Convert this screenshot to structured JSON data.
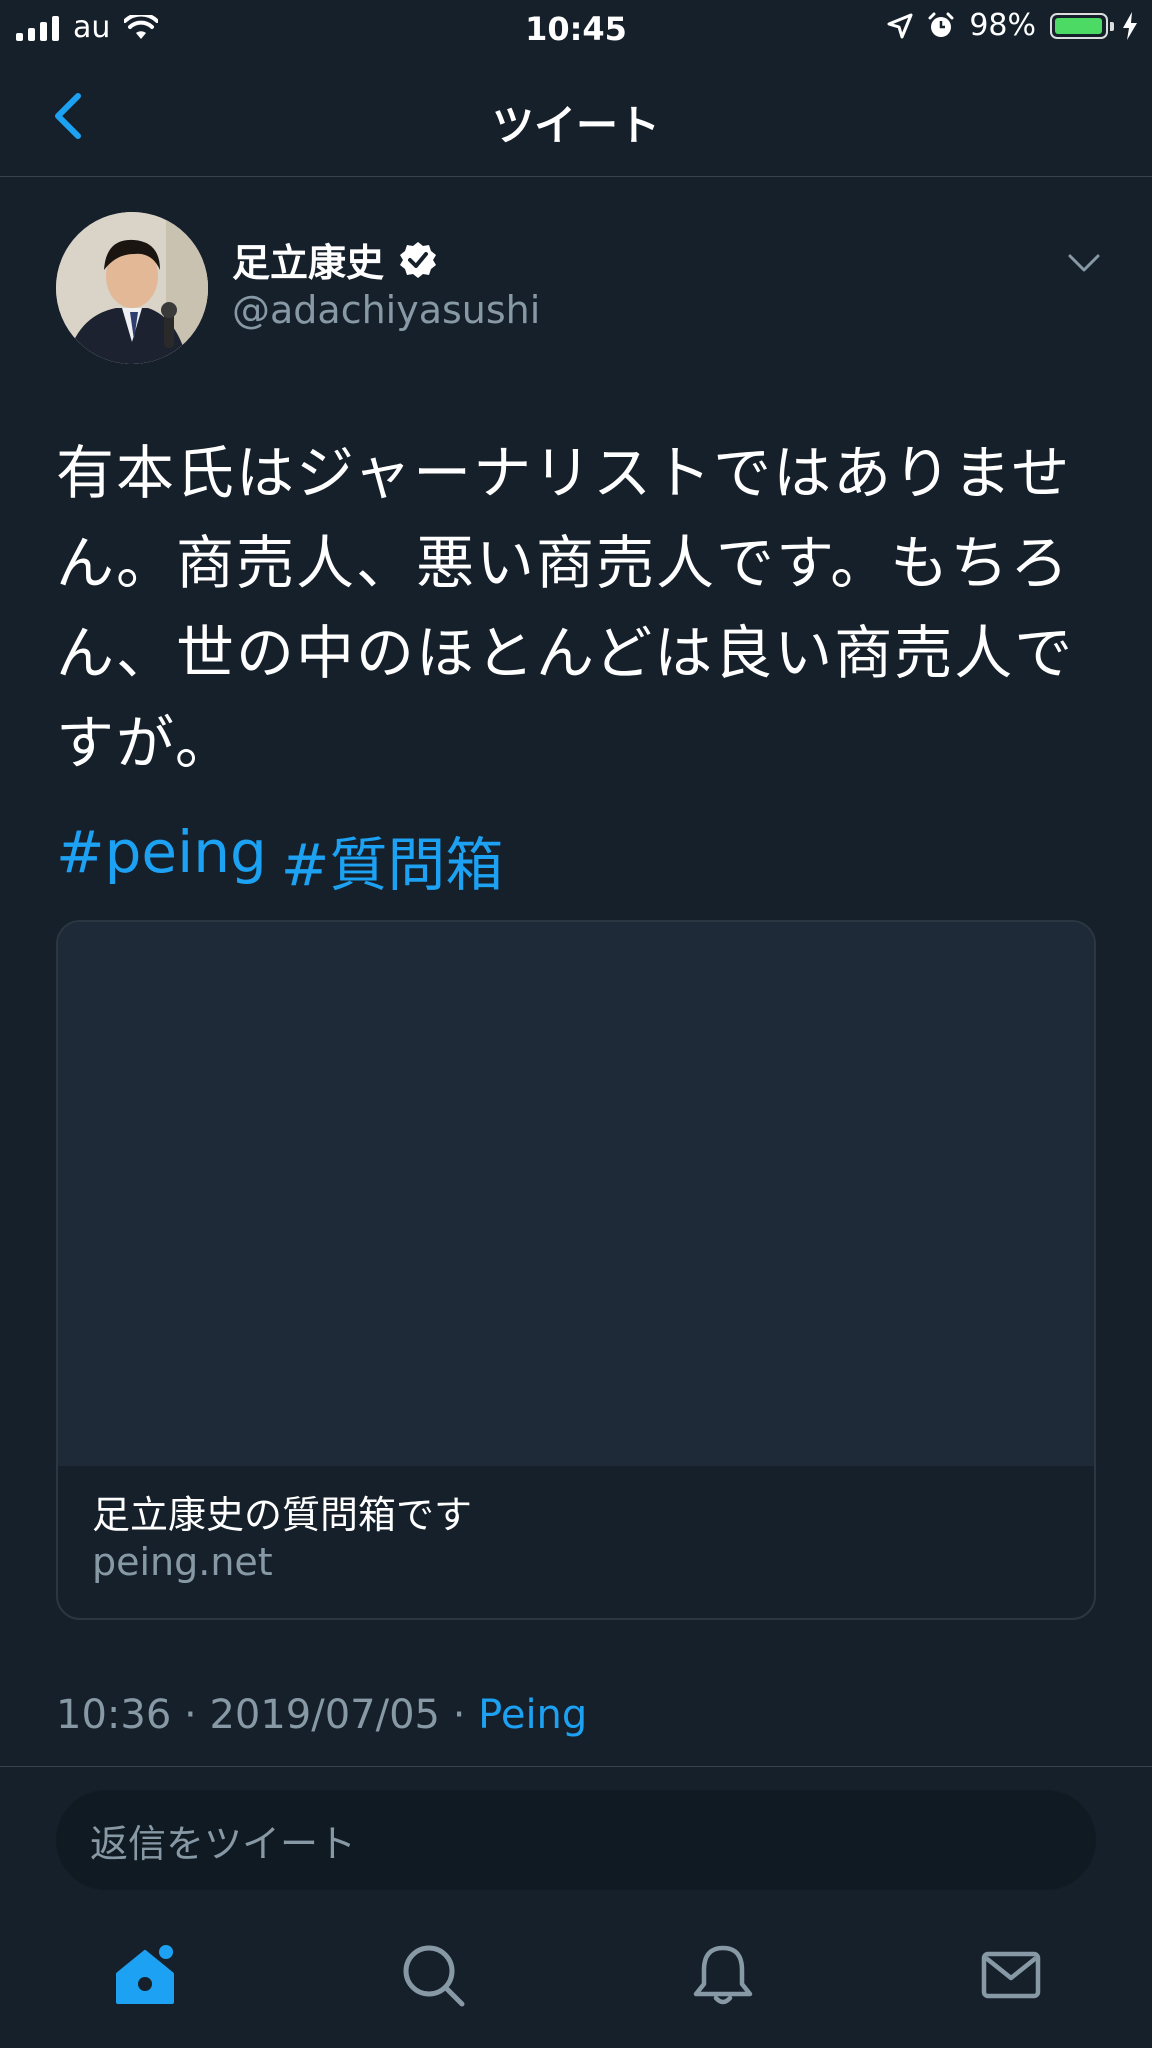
{
  "status_bar": {
    "carrier": "au",
    "time": "10:45",
    "battery_percent": "98%",
    "battery_level": 0.98
  },
  "header": {
    "title": "ツイート",
    "back_icon": "chevron-left-icon"
  },
  "tweet": {
    "author_name": "足立康史",
    "author_handle": "@adachiyasushi",
    "verified": true,
    "text": "有本氏はジャーナリストではありません。商売人、悪い商売人です。もちろん、世の中のほとんどは良い商売人ですが。",
    "hashtags": [
      "#peing",
      "#質問箱"
    ],
    "card": {
      "title": "足立康史の質問箱です",
      "domain": "peing.net"
    },
    "time": "10:36",
    "date": "2019/07/05",
    "source": "Peing",
    "separator": "·"
  },
  "reply": {
    "placeholder": "返信をツイート"
  },
  "tabs": [
    {
      "icon": "home-icon",
      "active": true
    },
    {
      "icon": "search-icon",
      "active": false
    },
    {
      "icon": "bell-icon",
      "active": false
    },
    {
      "icon": "mail-icon",
      "active": false
    }
  ],
  "colors": {
    "background": "#15202b",
    "accent": "#1da1f2",
    "muted": "#8899a6",
    "battery": "#4cd964"
  }
}
